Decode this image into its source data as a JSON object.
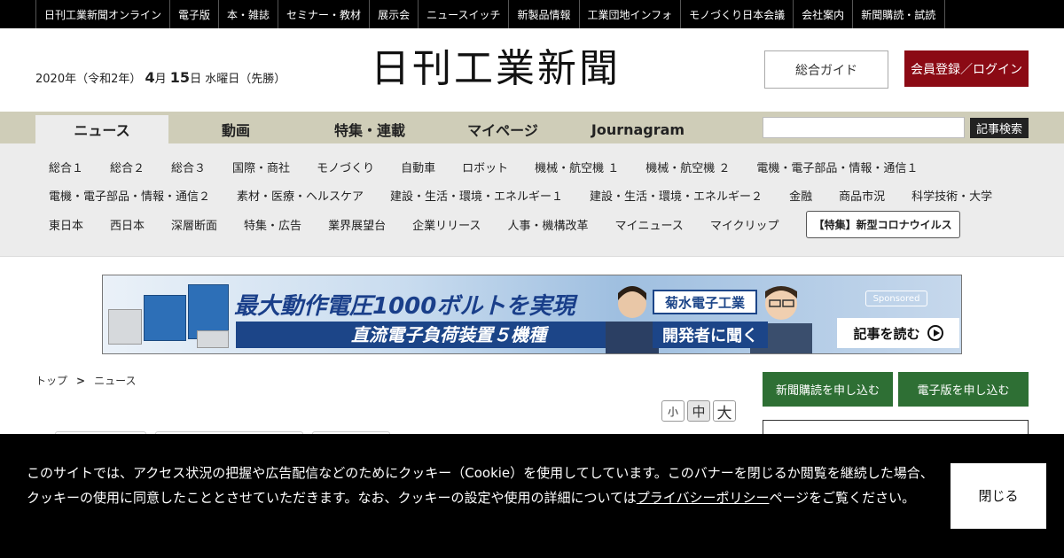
{
  "topnav": {
    "items": [
      "日刊工業新聞オンライン",
      "電子版",
      "本・雑誌",
      "セミナー・教材",
      "展示会",
      "ニュースイッチ",
      "新製品情報",
      "工業団地インフォ",
      "モノづくり日本会議",
      "会社案内",
      "新聞購読・試読"
    ]
  },
  "header": {
    "date_prefix": "2020年（令和2年）",
    "month": "4",
    "month_unit": "月",
    "day": "15",
    "day_suffix": "日 水曜日（先勝）",
    "logo": "日刊工業新聞",
    "guide_label": "総合ガイド",
    "login_label": "会員登録／ログイン"
  },
  "mainnav": {
    "tabs": [
      "ニュース",
      "動画",
      "特集・連載",
      "マイページ",
      "Journagram"
    ],
    "active": "ニュース",
    "search_placeholder": "",
    "search_button": "記事検索"
  },
  "subnav": {
    "row1": [
      "総合１",
      "総合２",
      "総合３",
      "国際・商社",
      "モノづくり",
      "自動車",
      "ロボット",
      "機械・航空機 １",
      "機械・航空機 ２",
      "電機・電子部品・情報・通信１"
    ],
    "row2": [
      "電機・電子部品・情報・通信２",
      "素材・医療・ヘルスケア",
      "建設・生活・環境・エネルギー１",
      "建設・生活・環境・エネルギー２",
      "金融",
      "商品市況",
      "科学技術・大学"
    ],
    "row3": [
      "東日本",
      "西日本",
      "深層断面",
      "特集・広告",
      "業界展望台",
      "企業リリース",
      "人事・機構改革",
      "マイニュース",
      "マイクリップ"
    ],
    "corona_label": "【特集】新型コロナウイルス"
  },
  "banner": {
    "headline": "最大動作電圧1000ボルトを実現",
    "subline": "直流電子負荷装置５機種",
    "company": "菊水電子工業",
    "interview": "開発者に聞く",
    "sponsored": "Sponsored",
    "cta": "記事を読む"
  },
  "breadcrumb": {
    "home": "トップ",
    "separator": ">",
    "current": "ニュース"
  },
  "font_size": {
    "small": "小",
    "medium": "中",
    "large": "大"
  },
  "side": {
    "subscribe_paper": "新聞購読を申し込む",
    "subscribe_digital": "電子版を申し込む"
  },
  "cookie": {
    "text_before": "このサイトでは、アクセス状況の把握や広告配信などのためにクッキー（Cookie）を使用してしています。このバナーを閉じるか閲覧を継続した場合、クッキーの使用に同意したこととさせていただきます。なお、クッキーの設定や使用の詳細については",
    "link": "プライバシーポリシー",
    "text_after": "ページをご覧ください。",
    "close_label": "閉じる"
  },
  "colors": {
    "topbar": "#000000",
    "login": "#8b0a14",
    "mainnav": "#cfcdb8",
    "subnav": "#ececec",
    "green": "#2e6f34"
  }
}
